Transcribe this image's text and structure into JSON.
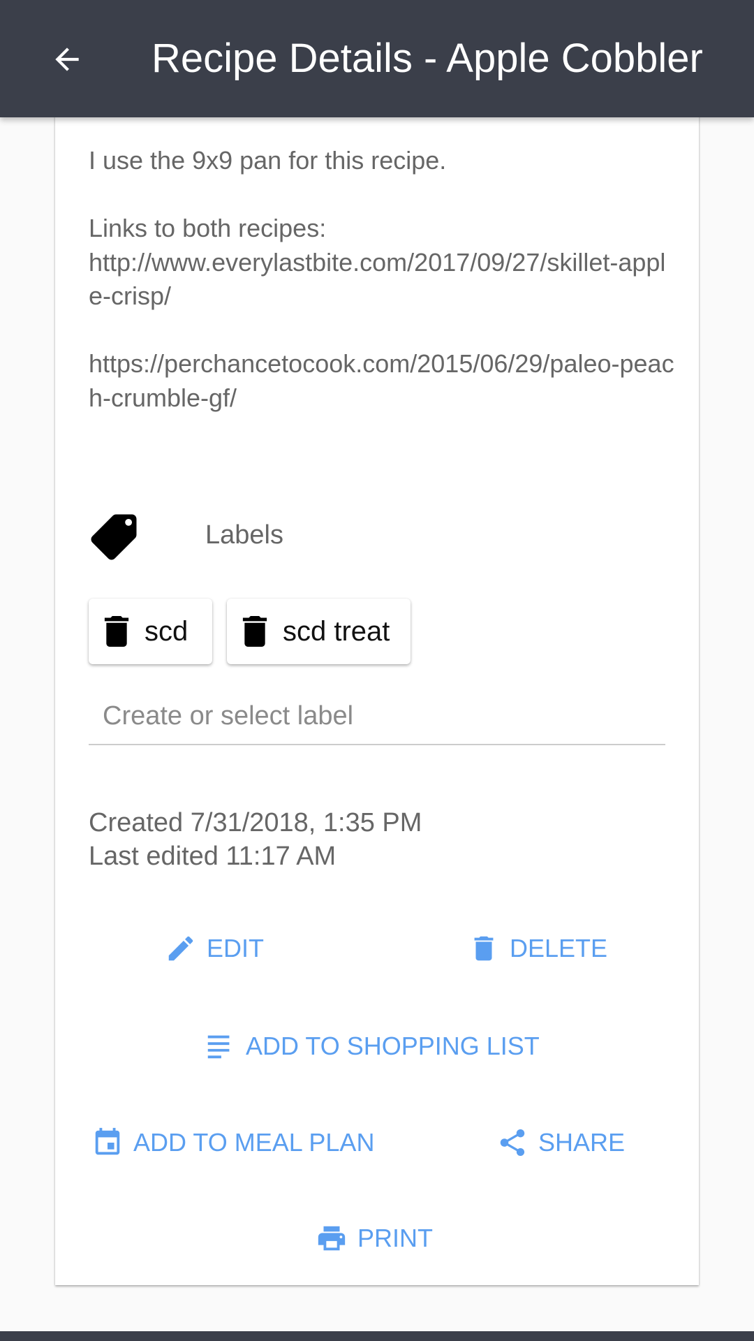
{
  "appbar": {
    "title": "Recipe Details - Apple Cobbler",
    "back_icon": "arrow-back-icon"
  },
  "notes": {
    "lines": [
      "I use the 9x9 pan for this recipe.",
      "",
      "Links to both recipes:",
      "http://www.everylastbite.com/2017/09/27/skillet-apple-crisp/",
      "",
      "https://perchancetocook.com/2015/06/29/paleo-peach-crumble-gf/"
    ]
  },
  "labels": {
    "title": "Labels",
    "icon": "tag-icon",
    "chips": [
      {
        "label": "scd",
        "delete_icon": "trash-icon"
      },
      {
        "label": "scd treat",
        "delete_icon": "trash-icon"
      }
    ],
    "input_placeholder": "Create or select label",
    "input_value": ""
  },
  "meta": {
    "created": "Created 7/31/2018, 1:35 PM",
    "edited": "Last edited 11:17 AM"
  },
  "actions": {
    "edit": {
      "label": "EDIT",
      "icon": "pencil-icon"
    },
    "delete": {
      "label": "DELETE",
      "icon": "trash-icon"
    },
    "shopping": {
      "label": "ADD TO SHOPPING LIST",
      "icon": "list-icon"
    },
    "meal_plan": {
      "label": "ADD TO MEAL PLAN",
      "icon": "calendar-icon"
    },
    "share": {
      "label": "SHARE",
      "icon": "share-icon"
    },
    "print": {
      "label": "PRINT",
      "icon": "printer-icon"
    }
  },
  "colors": {
    "appbar": "#3b3f4a",
    "accent": "#5a9ef0",
    "text_secondary": "#666666"
  }
}
